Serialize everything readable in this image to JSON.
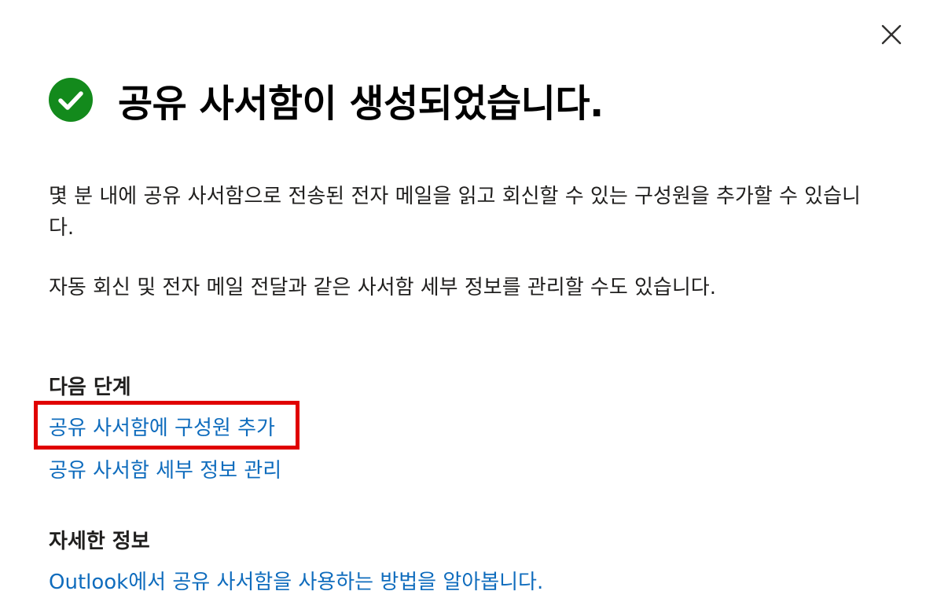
{
  "dialog": {
    "title": "공유 사서함이 생성되었습니다.",
    "close_icon": "close-icon",
    "status_icon": "checkmark-circle-icon",
    "status_color": "#138a1c",
    "description": [
      "몇 분 내에 공유 사서함으로 전송된 전자 메일을 읽고 회신할 수 있는 구성원을 추가할 수 있습니다.",
      "자동 회신 및 전자 메일 전달과 같은 사서함 세부 정보를 관리할 수도 있습니다."
    ],
    "next_steps": {
      "heading": "다음 단계",
      "links": [
        "공유 사서함에 구성원 추가",
        "공유 사서함 세부 정보 관리"
      ]
    },
    "more_info": {
      "heading": "자세한 정보",
      "link": "Outlook에서 공유 사서함을 사용하는 방법을 알아봅니다."
    },
    "link_color": "#0f6cbd",
    "highlight_color": "#e00000"
  }
}
